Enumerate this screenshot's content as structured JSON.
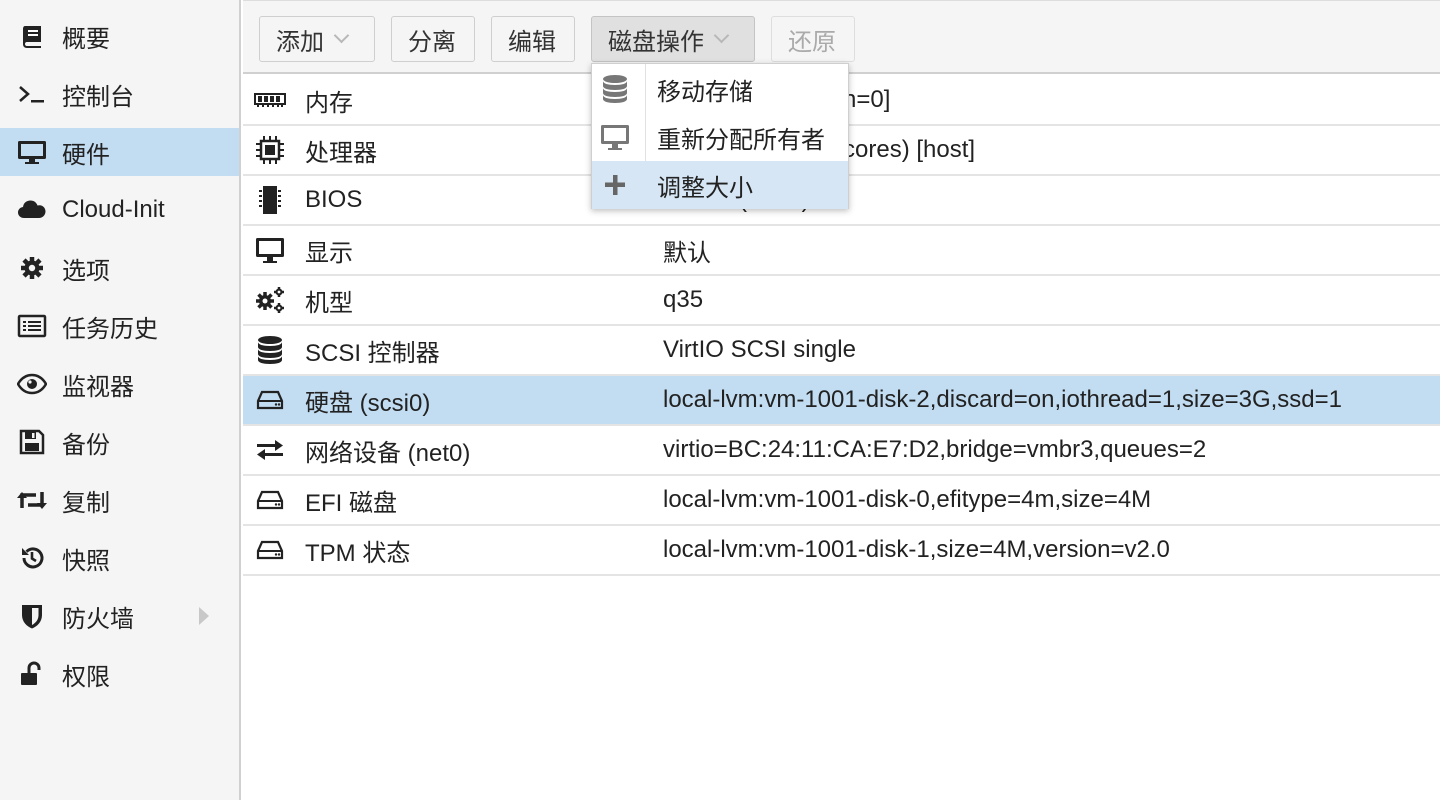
{
  "sidebar": {
    "items": [
      {
        "label": "概要",
        "icon": "book-icon"
      },
      {
        "label": "控制台",
        "icon": "terminal-icon"
      },
      {
        "label": "硬件",
        "icon": "monitor-icon",
        "active": true
      },
      {
        "label": "Cloud-Init",
        "icon": "cloud-icon"
      },
      {
        "label": "选项",
        "icon": "gear-icon"
      },
      {
        "label": "任务历史",
        "icon": "list-icon"
      },
      {
        "label": "监视器",
        "icon": "eye-icon"
      },
      {
        "label": "备份",
        "icon": "floppy-icon"
      },
      {
        "label": "复制",
        "icon": "retweet-icon"
      },
      {
        "label": "快照",
        "icon": "history-icon"
      },
      {
        "label": "防火墙",
        "icon": "shield-icon",
        "expandable": true
      },
      {
        "label": "权限",
        "icon": "unlock-icon"
      }
    ]
  },
  "toolbar": {
    "add_label": "添加",
    "detach_label": "分离",
    "edit_label": "编辑",
    "disk_action_label": "磁盘操作",
    "revert_label": "还原"
  },
  "disk_menu": {
    "items": [
      {
        "label": "移动存储",
        "icon": "database-icon"
      },
      {
        "label": "重新分配所有者",
        "icon": "desktop-icon"
      },
      {
        "label": "调整大小",
        "icon": "plus-icon",
        "hover": true
      }
    ]
  },
  "hardware": {
    "rows": [
      {
        "name": "内存",
        "value": "",
        "icon": "memory-icon",
        "visible_value_tail": "n=0]"
      },
      {
        "name": "处理器",
        "value": "",
        "icon": "cpu-icon",
        "visible_value_tail": "cores) [host]"
      },
      {
        "name": "BIOS",
        "value": "OVMF (UEFI)",
        "icon": "microchip-icon"
      },
      {
        "name": "显示",
        "value": "默认",
        "icon": "desktop-icon"
      },
      {
        "name": "机型",
        "value": "q35",
        "icon": "cogs-icon"
      },
      {
        "name": "SCSI 控制器",
        "value": "VirtIO SCSI single",
        "icon": "database-icon"
      },
      {
        "name": "硬盘 (scsi0)",
        "value": "local-lvm:vm-1001-disk-2,discard=on,iothread=1,size=3G,ssd=1",
        "icon": "hdd-icon",
        "selected": true
      },
      {
        "name": "网络设备 (net0)",
        "value": "virtio=BC:24:11:CA:E7:D2,bridge=vmbr3,queues=2",
        "icon": "exchange-icon"
      },
      {
        "name": "EFI 磁盘",
        "value": "local-lvm:vm-1001-disk-0,efitype=4m,size=4M",
        "icon": "hdd-icon"
      },
      {
        "name": "TPM 状态",
        "value": "local-lvm:vm-1001-disk-1,size=4M,version=v2.0",
        "icon": "hdd-icon"
      }
    ]
  },
  "colors": {
    "selection": "#c2ddf2",
    "menu_hover": "#d6e6f4",
    "panel_bg": "#f5f5f5"
  }
}
